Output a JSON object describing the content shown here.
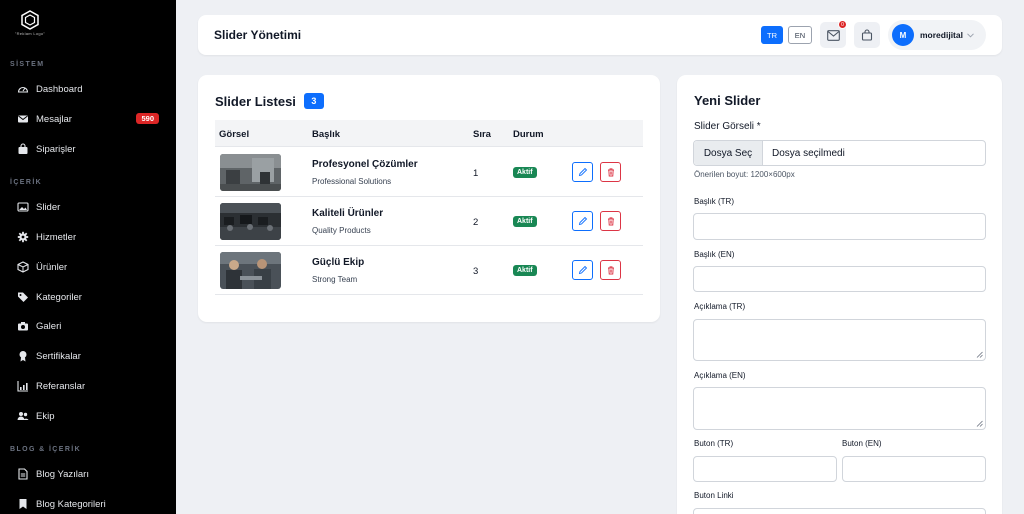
{
  "brand": {
    "logo_text": "\"Reklam Logo\""
  },
  "sidebar": {
    "sections": [
      {
        "label": "SİSTEM"
      },
      {
        "label": "İÇERİK"
      },
      {
        "label": "BLOG & İÇERİK"
      }
    ],
    "items": [
      {
        "label": "Dashboard",
        "icon": "speedometer-icon"
      },
      {
        "label": "Mesajlar",
        "icon": "envelope-icon",
        "badge": "590"
      },
      {
        "label": "Siparişler",
        "icon": "bag-icon"
      },
      {
        "label": "Slider",
        "icon": "images-icon"
      },
      {
        "label": "Hizmetler",
        "icon": "gear-icon"
      },
      {
        "label": "Ürünler",
        "icon": "box-icon"
      },
      {
        "label": "Kategoriler",
        "icon": "tags-icon"
      },
      {
        "label": "Galeri",
        "icon": "camera-icon"
      },
      {
        "label": "Sertifikalar",
        "icon": "award-icon"
      },
      {
        "label": "Referanslar",
        "icon": "chart-icon"
      },
      {
        "label": "Ekip",
        "icon": "people-icon"
      },
      {
        "label": "Blog Yazıları",
        "icon": "file-text-icon"
      },
      {
        "label": "Blog Kategorileri",
        "icon": "bookmark-icon"
      }
    ]
  },
  "header": {
    "title": "Slider Yönetimi",
    "lang_tr": "TR",
    "lang_en": "EN",
    "mail_badge": "0",
    "user_initial": "M",
    "user_name": "moredijital"
  },
  "list": {
    "title": "Slider Listesi",
    "count": "3",
    "columns": {
      "image": "Görsel",
      "title": "Başlık",
      "order": "Sıra",
      "status": "Durum"
    },
    "rows": [
      {
        "title": "Profesyonel Çözümler",
        "subtitle": "Professional Solutions",
        "order": "1",
        "status": "Aktif"
      },
      {
        "title": "Kaliteli Ürünler",
        "subtitle": "Quality Products",
        "order": "2",
        "status": "Aktif"
      },
      {
        "title": "Güçlü Ekip",
        "subtitle": "Strong Team",
        "order": "3",
        "status": "Aktif"
      }
    ]
  },
  "form": {
    "title": "Yeni Slider",
    "image_label": "Slider Görseli *",
    "file_button": "Dosya Seç",
    "file_status": "Dosya seçilmedi",
    "size_hint": "Önerilen boyut: 1200×600px",
    "title_tr_label": "Başlık (TR)",
    "title_en_label": "Başlık (EN)",
    "desc_tr_label": "Açıklama (TR)",
    "desc_en_label": "Açıklama (EN)",
    "button_tr_label": "Buton (TR)",
    "button_en_label": "Buton (EN)",
    "button_link_label": "Buton Linki"
  },
  "colors": {
    "primary": "#0d6efd",
    "success": "#198754",
    "danger": "#dc3545",
    "sidebar_bg": "#000000"
  }
}
